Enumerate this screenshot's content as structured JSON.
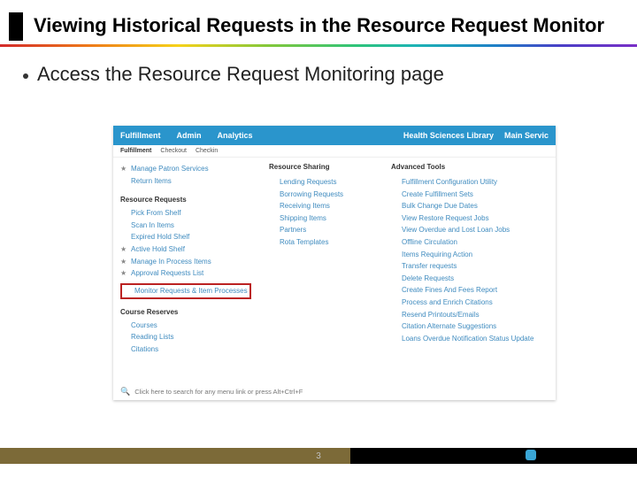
{
  "title": "Viewing Historical Requests in the Resource Request Monitor",
  "bullet": "Access the Resource Request Monitoring page",
  "page_number": "3",
  "menubar": {
    "left": [
      "Fulfillment",
      "Admin",
      "Analytics"
    ],
    "right": [
      "Health Sciences Library",
      "Main Servic"
    ]
  },
  "belowbar": {
    "section": "Fulfillment",
    "crumb1": "Checkout",
    "crumb2": "Checkin"
  },
  "col1": {
    "groups": [
      {
        "items": [
          {
            "star": true,
            "label": "Manage Patron Services"
          },
          {
            "star": false,
            "label": "Return Items"
          }
        ]
      },
      {
        "heading": "Resource Requests",
        "items": [
          {
            "star": false,
            "label": "Pick From Shelf"
          },
          {
            "star": false,
            "label": "Scan In Items"
          },
          {
            "star": false,
            "label": "Expired Hold Shelf"
          },
          {
            "star": true,
            "label": "Active Hold Shelf"
          },
          {
            "star": true,
            "label": "Manage In Process Items"
          },
          {
            "star": true,
            "label": "Approval Requests List"
          },
          {
            "star": false,
            "label": "Monitor Requests & Item Processes",
            "boxed": true
          }
        ]
      },
      {
        "heading": "Course Reserves",
        "items": [
          {
            "star": false,
            "label": "Courses"
          },
          {
            "star": false,
            "label": "Reading Lists"
          },
          {
            "star": false,
            "label": "Citations"
          }
        ]
      }
    ]
  },
  "col2": {
    "heading": "Resource Sharing",
    "items": [
      "Lending Requests",
      "Borrowing Requests",
      "Receiving Items",
      "Shipping Items",
      "Partners",
      "Rota Templates"
    ]
  },
  "col3": {
    "heading": "Advanced Tools",
    "items": [
      "Fulfillment Configuration Utility",
      "Create Fulfillment Sets",
      "Bulk Change Due Dates",
      "View Restore Request Jobs",
      "View Overdue and Lost Loan Jobs",
      "Offline Circulation",
      "Items Requiring Action",
      "Transfer requests",
      "Delete Requests",
      "Create Fines And Fees Report",
      "Process and Enrich Citations",
      "Resend Printouts/Emails",
      "Citation Alternate Suggestions",
      "Loans Overdue Notification Status Update"
    ]
  },
  "search_hint": "Click here  to search for any menu link or press Alt+Ctrl+F"
}
